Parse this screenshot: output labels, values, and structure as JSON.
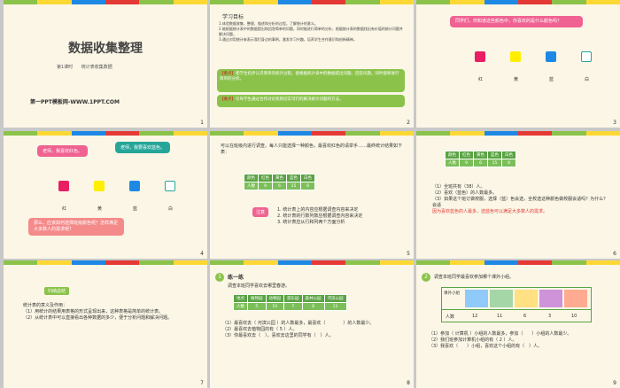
{
  "colors": {
    "green": "#8bc34a",
    "red": "#e53935",
    "pink": "#f06292",
    "yellow": "#ffee00",
    "blue": "#1e88e5",
    "magenta": "#e91e63",
    "teal": "#26a69a",
    "cream": "#fbf6e6"
  },
  "slides": [
    {
      "num": "1",
      "title": "数据收集整理",
      "subtitle_left": "第1课时",
      "subtitle_right": "统计表收集数据",
      "footer": "第一PPT模板网-WWW.1PPT.COM"
    },
    {
      "num": "2",
      "heading": "学习目标",
      "goals": [
        "1.体验数据收集、整理、描述和分析的过程，了解统计的意义。",
        "2.能根据统计表中的数据提出和回答简单的问题，同时能进行简单的分析，根据统计表的数据找出有价值的统计问题并解决问题。",
        "3.通过对用统计来表示我们身边的事例，激发学习兴趣，培养学生合作意识和创新精神。"
      ],
      "key_tag": "【重点】",
      "key_text": "使学生初步认识简单的统计过程，能根据统计表中的数据提出问题、回答问题。同时能够进行简单的分析。",
      "diff_tag": "【难点】",
      "diff_text": "引导学生通过合作讨论找到切实可行的解决统计问题的方法。"
    },
    {
      "num": "3",
      "question": "同学们，你知道这些颜色中，你喜欢的是什么颜色吗？",
      "colors": [
        "红",
        "黄",
        "蓝",
        "白"
      ]
    },
    {
      "num": "4",
      "bubble1": "老师，我喜欢红色。",
      "bubble2": "老师，我要喜欢蓝色。",
      "colors": [
        "红",
        "黄",
        "蓝",
        "白"
      ],
      "bubble3": "那么，应该如何选择班级颜色呢？怎样满足大多数人的需求呢？"
    },
    {
      "num": "5",
      "intro": "可以在班级内进行调查。每人只能选择一种颜色，最喜欢红色的请举手……最终统计结果如下表：",
      "table": {
        "head": [
          "颜色",
          "红色",
          "黄色",
          "蓝色",
          "白色"
        ],
        "row": [
          "人数",
          "9",
          "6",
          "15",
          "8"
        ]
      },
      "note_tag": "注意",
      "notes": [
        "1. 统计表上的内容应根据调查内容来决定",
        "2. 统计表的行数列数应根据调查内容来决定",
        "3. 统计表应从行和列两个方面分析"
      ]
    },
    {
      "num": "6",
      "table": {
        "head": [
          "颜色",
          "红色",
          "黄色",
          "蓝色",
          "白色"
        ],
        "row": [
          "人数",
          "9",
          "6",
          "15",
          "8"
        ]
      },
      "q1": "（1）全班共有（38）人。",
      "q2": "（2）喜欢（蓝色）的人数最多。",
      "q3": "（3）如果这个班订做校服，选择（蓝）色会选，全校选这种颜色做校服会适吗？为什么？会适",
      "answer": "因为喜欢蓝色的人最多，选蓝色可以满足大多数人的需求。"
    },
    {
      "num": "7",
      "tag": "归纳总结",
      "lines": [
        "统计表的意义及作用：",
        "（1）用统计的结果用表格的形式呈现出来，这种表格是简单的统计表。",
        "（2）从统计表中可以直接看出各种数据的多少，便于分析问题和解决问题。"
      ]
    },
    {
      "num": "8",
      "badge": "1",
      "heading": "练一练",
      "intro": "调查本班同学喜欢去哪里春游。",
      "table": {
        "head": [
          "地点",
          "植物园",
          "动物园",
          "游乐园",
          "森林公园",
          "河滨公园"
        ],
        "row": [
          "人数",
          "5",
          "10",
          "7",
          "8",
          "11"
        ]
      },
      "q1": "（1）最喜欢去（ 河滨公园 ）的人数最多，最喜欢（　　　　）的人数最少。",
      "q2": "（2）最喜欢去植物园的有（ 5 ）人。",
      "q3": "（3）你最喜欢去（　），喜欢去这里的同学有（　）人。"
    },
    {
      "num": "9",
      "badge": "2",
      "heading": "调查本班同学最喜欢参加哪个课外小组。",
      "table": {
        "head": [
          "课外小组",
          "",
          "",
          "",
          "",
          ""
        ],
        "row": [
          "人数",
          "12",
          "11",
          "6",
          "3",
          "10"
        ]
      },
      "q1": "（1）参加（ 计算机 ）小组的人数最多，参加（　　）小组的人数最少。",
      "q2": "（2）我们班参加计算机小组的有（ 2 ）人。",
      "q3": "（3）我喜欢（　　）小组，喜欢这个小组的有（　）人。"
    }
  ]
}
